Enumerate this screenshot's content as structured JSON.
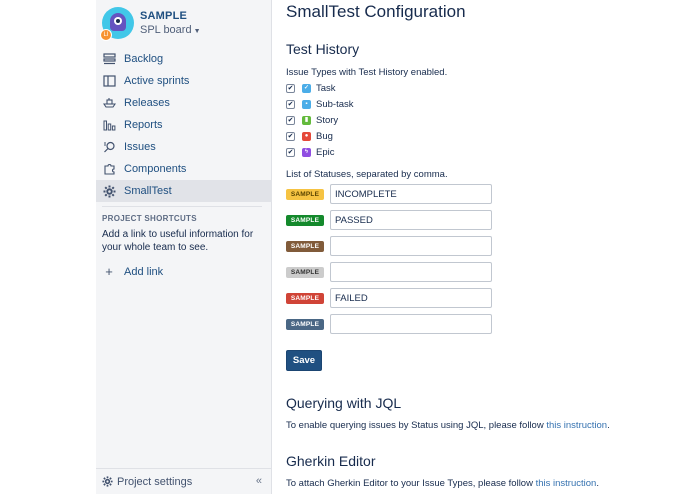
{
  "project": {
    "name": "SAMPLE",
    "board": "SPL board",
    "avatar_badge": "LI"
  },
  "sidebar": {
    "items": [
      {
        "label": "Backlog",
        "icon": "backlog-icon"
      },
      {
        "label": "Active sprints",
        "icon": "board-icon"
      },
      {
        "label": "Releases",
        "icon": "ship-icon"
      },
      {
        "label": "Reports",
        "icon": "chart-icon"
      },
      {
        "label": "Issues",
        "icon": "search-icon"
      },
      {
        "label": "Components",
        "icon": "puzzle-icon"
      },
      {
        "label": "SmallTest",
        "icon": "gear-icon",
        "active": true
      }
    ],
    "shortcuts_title": "PROJECT SHORTCUTS",
    "shortcuts_desc": "Add a link to useful information for your whole team to see.",
    "add_link": "Add link",
    "settings_label": "Project settings",
    "collapse_glyph": "«"
  },
  "main": {
    "title": "SmallTest Configuration",
    "test_history": {
      "heading": "Test History",
      "issue_types_label": "Issue Types with Test History enabled.",
      "types": [
        {
          "name": "Task",
          "checked": true,
          "icon": "task-icon",
          "color": "#4bade8",
          "glyph": "✓"
        },
        {
          "name": "Sub-task",
          "checked": true,
          "icon": "subtask-icon",
          "color": "#4bade8",
          "glyph": "▪"
        },
        {
          "name": "Story",
          "checked": true,
          "icon": "story-icon",
          "color": "#63ba3c",
          "glyph": "▮"
        },
        {
          "name": "Bug",
          "checked": true,
          "icon": "bug-icon",
          "color": "#e5493a",
          "glyph": "●"
        },
        {
          "name": "Epic",
          "checked": true,
          "icon": "epic-icon",
          "color": "#904ee2",
          "glyph": "ϟ"
        }
      ],
      "statuses_label": "List of Statuses, separated by comma.",
      "statuses": [
        {
          "lozenge": "SAMPLE",
          "bg": "#f6c342",
          "fg": "#594300",
          "value": ""
        },
        {
          "lozenge": "SAMPLE",
          "bg": "#14892c",
          "fg": "#ffffff",
          "value": "PASSED"
        },
        {
          "lozenge": "SAMPLE",
          "bg": "#815b3a",
          "fg": "#ffffff",
          "value": ""
        },
        {
          "lozenge": "SAMPLE",
          "bg": "#cccccc",
          "fg": "#333333",
          "value": ""
        },
        {
          "lozenge": "SAMPLE",
          "bg": "#d04437",
          "fg": "#ffffff",
          "value": "FAILED"
        },
        {
          "lozenge": "SAMPLE",
          "bg": "#4a6785",
          "fg": "#ffffff",
          "value": ""
        }
      ],
      "statuses_first_value": "INCOMPLETE",
      "save_label": "Save"
    },
    "jql": {
      "heading": "Querying with JQL",
      "text": "To enable querying issues by Status using JQL, please follow ",
      "link": "this instruction",
      "suffix": "."
    },
    "gherkin": {
      "heading": "Gherkin Editor",
      "text": "To attach Gherkin Editor to your Issue Types, please follow ",
      "link": "this instruction",
      "suffix": "."
    }
  }
}
